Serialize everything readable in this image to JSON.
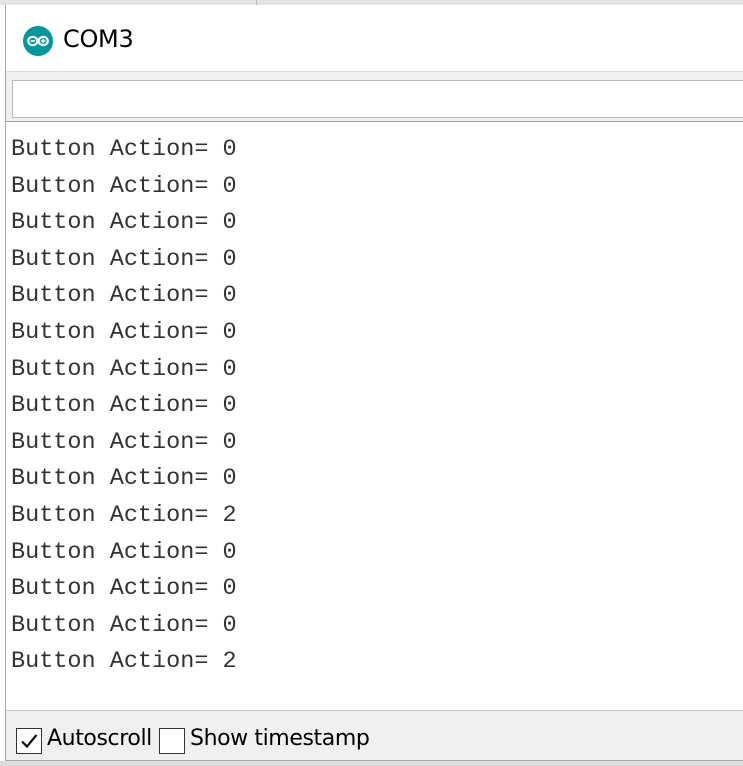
{
  "window": {
    "title": "COM3",
    "icon": "arduino-icon",
    "accent_color": "#00979d"
  },
  "send_bar": {
    "value": ""
  },
  "output": {
    "lines": [
      "Button Action= 0",
      "Button Action= 0",
      "Button Action= 0",
      "Button Action= 0",
      "Button Action= 0",
      "Button Action= 0",
      "Button Action= 0",
      "Button Action= 0",
      "Button Action= 0",
      "Button Action= 0",
      "Button Action= 2",
      "Button Action= 0",
      "Button Action= 0",
      "Button Action= 0",
      "Button Action= 2"
    ]
  },
  "status": {
    "autoscroll": {
      "label": "Autoscroll",
      "checked": true
    },
    "show_timestamp": {
      "label": "Show timestamp",
      "checked": false
    }
  }
}
